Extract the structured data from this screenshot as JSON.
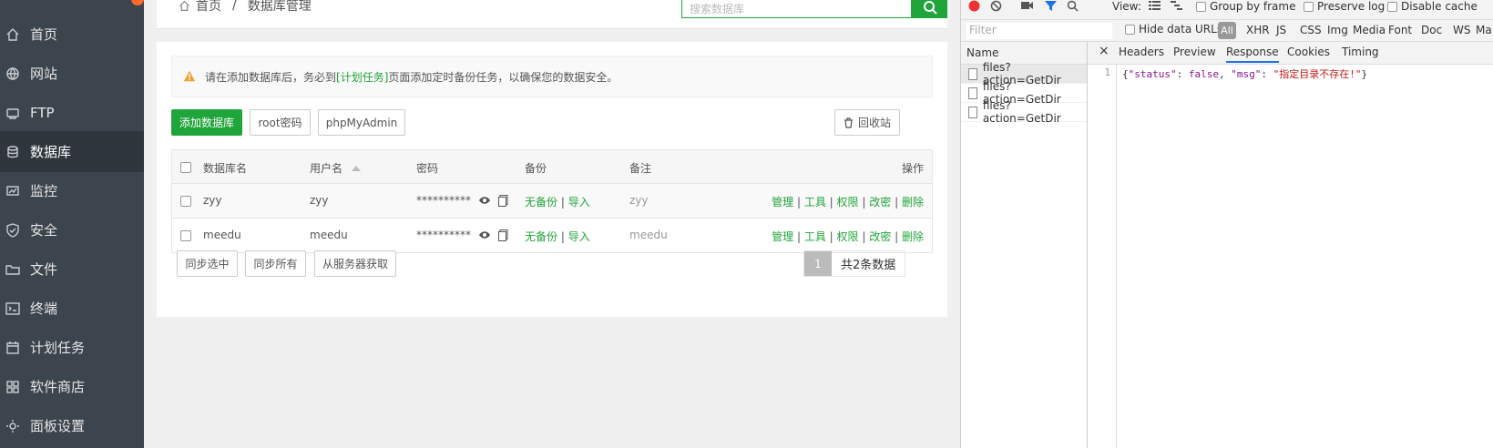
{
  "sidebar": {
    "items": [
      {
        "label": "首页",
        "icon": "home-icon"
      },
      {
        "label": "网站",
        "icon": "globe-icon"
      },
      {
        "label": "FTP",
        "icon": "ftp-icon"
      },
      {
        "label": "数据库",
        "icon": "database-icon",
        "active": true
      },
      {
        "label": "监控",
        "icon": "monitor-icon"
      },
      {
        "label": "安全",
        "icon": "shield-icon"
      },
      {
        "label": "文件",
        "icon": "folder-icon"
      },
      {
        "label": "终端",
        "icon": "terminal-icon"
      },
      {
        "label": "计划任务",
        "icon": "calendar-icon"
      },
      {
        "label": "软件商店",
        "icon": "grid-icon"
      },
      {
        "label": "面板设置",
        "icon": "settings-icon"
      }
    ]
  },
  "breadcrumb": {
    "home": "首页",
    "sep": "/",
    "current": "数据库管理"
  },
  "search": {
    "placeholder": "搜索数据库"
  },
  "alert": {
    "before": "请在添加数据库后，务必到",
    "link": "[计划任务]",
    "after": "页面添加定时备份任务，以确保您的数据安全。"
  },
  "toolbar": {
    "add": "添加数据库",
    "root": "root密码",
    "pma": "phpMyAdmin",
    "recycle": "回收站"
  },
  "table": {
    "headers": {
      "name": "数据库名",
      "user": "用户名",
      "password": "密码",
      "backup": "备份",
      "note": "备注",
      "ops": "操作"
    },
    "rows": [
      {
        "name": "zyy",
        "user": "zyy",
        "password": "**********",
        "backup": "无备份",
        "import": "导入",
        "note": "zyy"
      },
      {
        "name": "meedu",
        "user": "meedu",
        "password": "**********",
        "backup": "无备份",
        "import": "导入",
        "note": "meedu"
      }
    ],
    "ops": {
      "manage": "管理",
      "tool": "工具",
      "perm": "权限",
      "chpwd": "改密",
      "del": "删除",
      "sep": "|"
    }
  },
  "footer": {
    "sync_sel": "同步选中",
    "sync_all": "同步所有",
    "from_server": "从服务器获取",
    "page": "1",
    "total": "共2条数据"
  },
  "devtools": {
    "toolbar": {
      "view": "View:",
      "group": "Group by frame",
      "preserve": "Preserve log",
      "disable": "Disable cache"
    },
    "filter": {
      "placeholder": "Filter",
      "hide_urls": "Hide data URLs",
      "types": [
        "All",
        "XHR",
        "JS",
        "CSS",
        "Img",
        "Media",
        "Font",
        "Doc",
        "WS",
        "Ma"
      ]
    },
    "name_header": "Name",
    "requests": [
      "files?action=GetDir",
      "files?action=GetDir",
      "files?action=GetDir"
    ],
    "tabs": [
      "Headers",
      "Preview",
      "Response",
      "Cookies",
      "Timing"
    ],
    "close": "×",
    "response": {
      "line": "1",
      "open": "{",
      "k1": "\"status\"",
      "c1": ": ",
      "v1": "false",
      "comma": ", ",
      "k2": "\"msg\"",
      "c2": ": ",
      "v2": "\"指定目录不存在!\"",
      "close": "}"
    }
  }
}
